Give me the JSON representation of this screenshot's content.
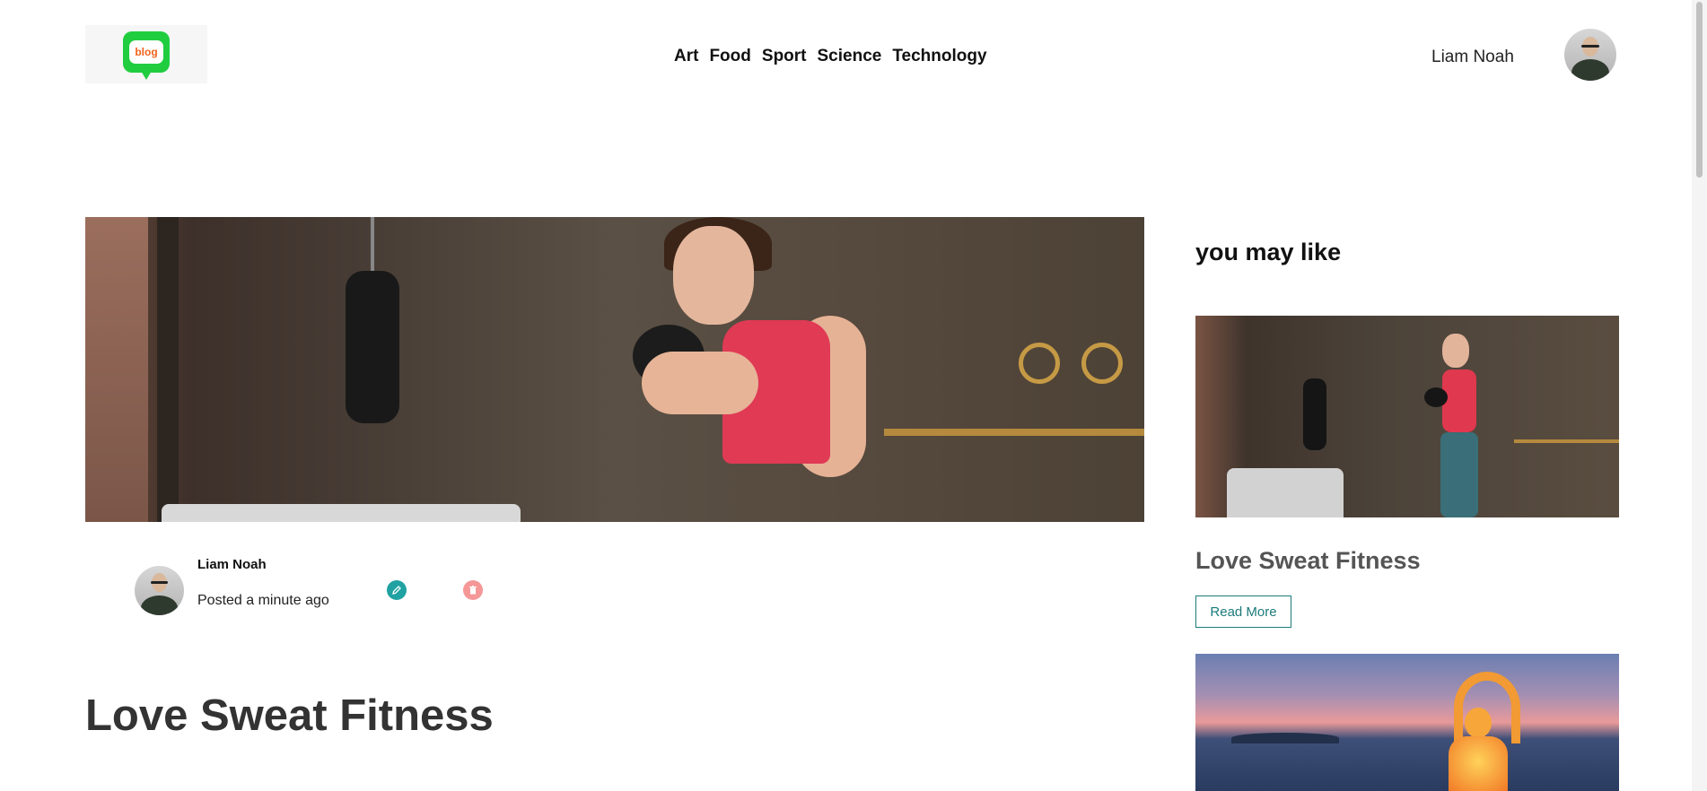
{
  "header": {
    "logo_text": "blog",
    "nav": [
      "Art",
      "Food",
      "Sport",
      "Science",
      "Technology"
    ],
    "user_name": "Liam Noah"
  },
  "post": {
    "author": "Liam Noah",
    "posted": "Posted a minute ago",
    "title": "Love Sweat Fitness"
  },
  "sidebar": {
    "heading": "you may like",
    "cards": [
      {
        "title": "Love Sweat Fitness",
        "button": "Read More"
      }
    ]
  },
  "colors": {
    "logo_green": "#1fcd3f",
    "logo_text": "#f0641e",
    "edit_teal": "#21a2a2",
    "delete_pink": "#f59797",
    "read_more_border": "#1d7a7a"
  }
}
